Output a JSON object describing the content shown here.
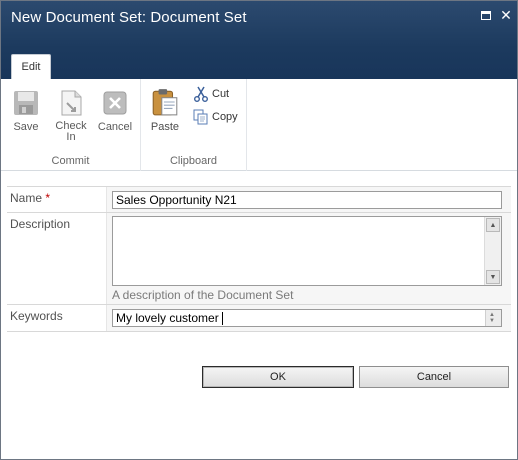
{
  "dialog": {
    "title": "New Document Set: Document Set"
  },
  "ribbon": {
    "tab_label": "Edit",
    "commit": {
      "group_label": "Commit",
      "save_label": "Save",
      "check_in_label_line1": "Check",
      "check_in_label_line2": "In",
      "cancel_label": "Cancel"
    },
    "clipboard": {
      "group_label": "Clipboard",
      "paste_label": "Paste",
      "cut_label": "Cut",
      "copy_label": "Copy"
    }
  },
  "form": {
    "name": {
      "label": "Name",
      "required_marker": "*",
      "value": "Sales Opportunity N21"
    },
    "description": {
      "label": "Description",
      "value": "",
      "hint": "A description of the Document Set"
    },
    "keywords": {
      "label": "Keywords",
      "value": "My lovely customer"
    }
  },
  "actions": {
    "ok_label": "OK",
    "cancel_label": "Cancel"
  }
}
